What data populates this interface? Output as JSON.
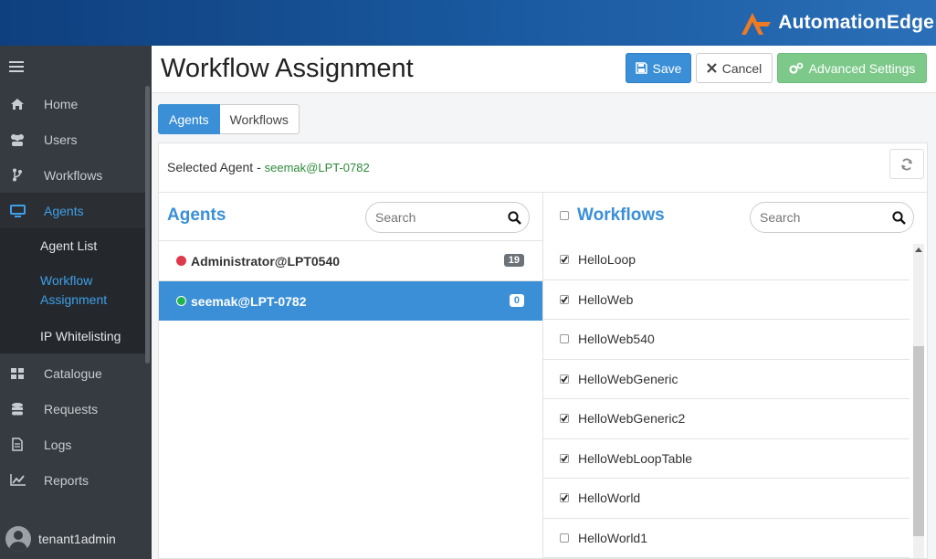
{
  "brand": {
    "name": "AutomationEdge"
  },
  "sidebar": {
    "items": [
      {
        "label": "Home",
        "icon": "home-icon"
      },
      {
        "label": "Users",
        "icon": "users-icon"
      },
      {
        "label": "Workflows",
        "icon": "workflow-icon"
      },
      {
        "label": "Agents",
        "icon": "monitor-icon"
      },
      {
        "label": "Catalogue",
        "icon": "grid-icon"
      },
      {
        "label": "Requests",
        "icon": "database-icon"
      },
      {
        "label": "Logs",
        "icon": "file-icon"
      },
      {
        "label": "Reports",
        "icon": "chart-icon"
      }
    ],
    "sub": {
      "agent_list": "Agent List",
      "workflow_assignment_1": "Workflow",
      "workflow_assignment_2": "Assignment",
      "ip_whitelisting": "IP Whitelisting"
    },
    "user": "tenant1admin"
  },
  "header": {
    "title": "Workflow Assignment",
    "save": "Save",
    "cancel": "Cancel",
    "advanced": "Advanced Settings"
  },
  "tabs": {
    "agents": "Agents",
    "workflows": "Workflows"
  },
  "selected": {
    "label": "Selected Agent -",
    "value": "seemak@LPT-0782"
  },
  "agents": {
    "title": "Agents",
    "search_placeholder": "Search",
    "rows": [
      {
        "name": "Administrator@LPT0540",
        "count": "19",
        "status": "offline",
        "color": "#e0394b"
      },
      {
        "name": "seemak@LPT-0782",
        "count": "0",
        "status": "online",
        "color": "#22b24c"
      }
    ]
  },
  "workflows": {
    "title": "Workflows",
    "search_placeholder": "Search",
    "rows": [
      {
        "name": "HelloLoop",
        "checked": true
      },
      {
        "name": "HelloWeb",
        "checked": true
      },
      {
        "name": "HelloWeb540",
        "checked": false
      },
      {
        "name": "HelloWebGeneric",
        "checked": true
      },
      {
        "name": "HelloWebGeneric2",
        "checked": true
      },
      {
        "name": "HelloWebLoopTable",
        "checked": true
      },
      {
        "name": "HelloWorld",
        "checked": true
      },
      {
        "name": "HelloWorld1",
        "checked": false
      }
    ]
  }
}
